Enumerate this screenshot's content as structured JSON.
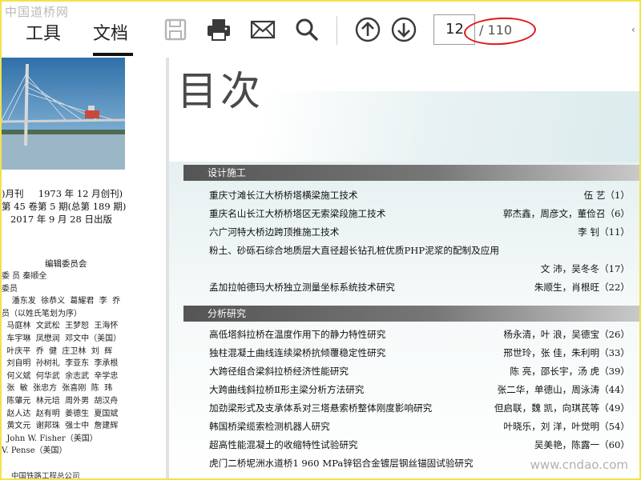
{
  "watermark": {
    "top_left": "中国道桥网",
    "bottom_right": "www.cndao.com"
  },
  "toolbar": {
    "tabs": [
      {
        "label": "工具"
      },
      {
        "label": "文档"
      }
    ],
    "active_tab": "文档",
    "buttons": [
      "save",
      "print",
      "email",
      "search",
      "prev-page",
      "next-page"
    ],
    "page_input": "12",
    "page_total": "/ 110",
    "right_edge": "‹"
  },
  "left_page": {
    "info_lines": [
      ")月刊     1973 年 12 月创刊)",
      "第 45 卷第 5 期(总第 189 期)",
      "   2017 年 9 月 28 日出版"
    ],
    "editorial_title": "编辑委员会",
    "editorial_lines": [
      "委 员 秦顺全",
      "委员",
      "    潘东发  徐恭义  葛耀君  李  乔",
      "员（以姓氏笔划为序）",
      "  马庭林  文武松  王梦恕  王海怀",
      "  车宇琳  凤懋润  邓文中（美国）",
      "  叶庆平  乔  健  庄卫林  刘  辉",
      "  刘自明  孙树礼  李亚东  李承根",
      "  何义斌  何华武  余志武  辛学忠",
      "  张  敏  张忠方  张喜刚  陈  玮",
      "  陈肇元  林元培  周外男  胡汉舟",
      "  赵人达  赵有明  姜德生  夏国斌",
      "  黄文元  谢邦珠  强士中  詹建辉",
      "  John W. Fisher（美国）",
      "V. Pense（美国）"
    ],
    "publisher": "中国铁路工程总公司"
  },
  "right_page": {
    "heading": "目次",
    "sections": [
      {
        "title": "设计施工",
        "entries": [
          {
            "title": "重庆寸滩长江大桥桥塔横梁施工技术",
            "authors": "伍  艺（1）"
          },
          {
            "title": "重庆名山长江大桥桥塔区无索梁段施工技术",
            "authors": "郭杰鑫，周彦文，董俭召（6）"
          },
          {
            "title": "六广河特大桥边跨顶推施工技术",
            "authors": "李  钊（11）"
          },
          {
            "title": "粉土、砂砾石综合地质层大直径超长钻孔桩优质PHP泥浆的配制及应用",
            "authors": ""
          },
          {
            "title": "",
            "authors": "文  沛，吴冬冬（17）"
          },
          {
            "title": "孟加拉帕德玛大桥独立测量坐标系统技术研究",
            "authors": "朱顺生，肖根旺（22）"
          }
        ]
      },
      {
        "title": "分析研究",
        "entries": [
          {
            "title": "高低塔斜拉桥在温度作用下的静力特性研究",
            "authors": "杨永清，叶  浪，吴德宝（26）"
          },
          {
            "title": "独柱混凝土曲线连续梁桥抗倾覆稳定性研究",
            "authors": "邢世玲，张  佳，朱利明（33）"
          },
          {
            "title": "大跨径组合梁斜拉桥经济性能研究",
            "authors": "陈  亮，邵长宇，汤  虎（39）"
          },
          {
            "title": "大跨曲线斜拉桥Ⅱ形主梁分析方法研究",
            "authors": "张二华，单德山，周泳涛（44）"
          },
          {
            "title": "加劲梁形式及支承体系对三塔悬索桥整体刚度影响研究",
            "authors": "但启联，魏  凯，向琪芪等（49）"
          },
          {
            "title": "韩国桥梁缆索检测机器人研究",
            "authors": "叶晓乐，刘  洋，叶觉明（54）"
          },
          {
            "title": "超高性能混凝土的收缩特性试验研究",
            "authors": "吴美艳，陈露一（60）"
          },
          {
            "title": "虎门二桥坭洲水道桥1 960 MPa锌铝合金镀层钢丝锚固试验研究",
            "authors": ""
          }
        ]
      }
    ]
  },
  "colors": {
    "frame": "#f2e34a",
    "annotation": "#e01818",
    "cover": "#2d6fa6"
  }
}
